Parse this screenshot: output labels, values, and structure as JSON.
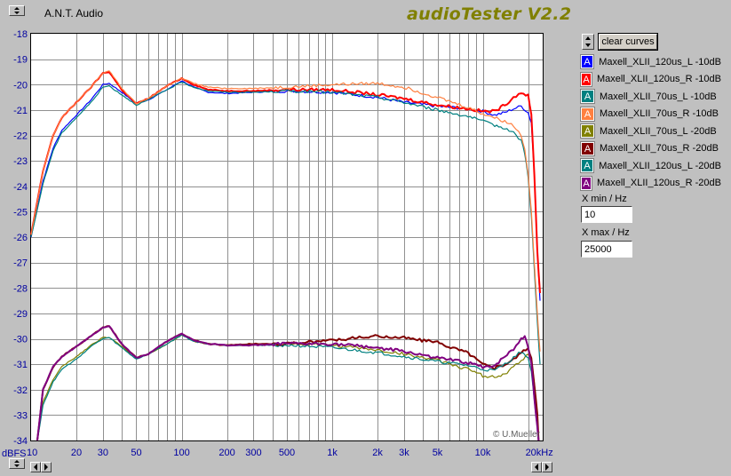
{
  "window": {
    "title": "A.N.T. Audio",
    "brand": "audioTester V2.2"
  },
  "controls": {
    "clear_curves_label": "clear curves",
    "xmin_label": "X min / Hz",
    "xmin_value": "10",
    "xmax_label": "X max / Hz",
    "xmax_value": "25000"
  },
  "legend_items": [
    {
      "label": "Maxell_XLII_120us_L -10dB",
      "color": "#0000ff",
      "glyph": "A"
    },
    {
      "label": "Maxell_XLII_120us_R -10dB",
      "color": "#ff0000",
      "glyph": "A"
    },
    {
      "label": "Maxell_XLII_70us_L -10dB",
      "color": "#008080",
      "glyph": "A"
    },
    {
      "label": "Maxell_XLII_70us_R -10dB",
      "color": "#ff8040",
      "glyph": "A"
    },
    {
      "label": "Maxell_XLII_70us_L -20dB",
      "color": "#808000",
      "glyph": "A"
    },
    {
      "label": "Maxell_XLII_70us_R -20dB",
      "color": "#800000",
      "glyph": "A"
    },
    {
      "label": "Maxell_XLII_120us_L -20dB",
      "color": "#008080",
      "glyph": "A"
    },
    {
      "label": "Maxell_XLII_120us_R -20dB",
      "color": "#800080",
      "glyph": "A"
    }
  ],
  "chart_data": {
    "type": "line",
    "x_scale": "log",
    "xlim": [
      10,
      25000
    ],
    "ylim": [
      -34,
      -18
    ],
    "ylabel": "dBFS",
    "xticks": [
      {
        "v": 10,
        "label": "10"
      },
      {
        "v": 20,
        "label": "20"
      },
      {
        "v": 30,
        "label": "30"
      },
      {
        "v": 50,
        "label": "50"
      },
      {
        "v": 100,
        "label": "100"
      },
      {
        "v": 200,
        "label": "200"
      },
      {
        "v": 300,
        "label": "300"
      },
      {
        "v": 500,
        "label": "500"
      },
      {
        "v": 1000,
        "label": "1k"
      },
      {
        "v": 2000,
        "label": "2k"
      },
      {
        "v": 3000,
        "label": "3k"
      },
      {
        "v": 5000,
        "label": "5k"
      },
      {
        "v": 10000,
        "label": "10k"
      },
      {
        "v": 20000,
        "label": "20kHz"
      }
    ],
    "yticks": [
      -18,
      -19,
      -20,
      -21,
      -22,
      -23,
      -24,
      -25,
      -26,
      -27,
      -28,
      -29,
      -30,
      -31,
      -32,
      -33,
      -34
    ],
    "grid": true,
    "annotation": "© U.Mueller",
    "series": [
      {
        "name": "Maxell_XLII_120us_L -10dB",
        "color": "#0000ff",
        "points": [
          [
            10,
            -26
          ],
          [
            12,
            -23.8
          ],
          [
            14,
            -22.5
          ],
          [
            16,
            -21.8
          ],
          [
            20,
            -21.2
          ],
          [
            25,
            -20.6
          ],
          [
            30,
            -20.0
          ],
          [
            33,
            -19.95
          ],
          [
            40,
            -20.3
          ],
          [
            50,
            -20.75
          ],
          [
            60,
            -20.6
          ],
          [
            80,
            -20.2
          ],
          [
            100,
            -19.85
          ],
          [
            120,
            -20.1
          ],
          [
            150,
            -20.3
          ],
          [
            200,
            -20.35
          ],
          [
            300,
            -20.3
          ],
          [
            500,
            -20.25
          ],
          [
            1000,
            -20.3
          ],
          [
            2000,
            -20.5
          ],
          [
            3000,
            -20.7
          ],
          [
            5000,
            -20.85
          ],
          [
            8000,
            -20.95
          ],
          [
            10000,
            -21.05
          ],
          [
            12000,
            -21.2
          ],
          [
            14000,
            -21.1
          ],
          [
            16000,
            -20.95
          ],
          [
            18000,
            -20.85
          ],
          [
            20000,
            -21.1
          ],
          [
            21000,
            -21.5
          ],
          [
            22000,
            -23.5
          ],
          [
            23000,
            -26.5
          ],
          [
            24000,
            -28.5
          ]
        ]
      },
      {
        "name": "Maxell_XLII_120us_R -10dB",
        "color": "#ff0000",
        "points": [
          [
            10,
            -25.9
          ],
          [
            12,
            -23.4
          ],
          [
            14,
            -22.0
          ],
          [
            16,
            -21.3
          ],
          [
            20,
            -20.7
          ],
          [
            25,
            -20.1
          ],
          [
            30,
            -19.55
          ],
          [
            33,
            -19.5
          ],
          [
            40,
            -20.2
          ],
          [
            50,
            -20.75
          ],
          [
            60,
            -20.55
          ],
          [
            80,
            -20.05
          ],
          [
            100,
            -19.75
          ],
          [
            120,
            -20.0
          ],
          [
            150,
            -20.2
          ],
          [
            200,
            -20.25
          ],
          [
            300,
            -20.25
          ],
          [
            500,
            -20.2
          ],
          [
            1000,
            -20.2
          ],
          [
            2000,
            -20.4
          ],
          [
            3000,
            -20.55
          ],
          [
            5000,
            -20.8
          ],
          [
            8000,
            -20.95
          ],
          [
            10000,
            -21.05
          ],
          [
            12000,
            -21.05
          ],
          [
            14000,
            -20.8
          ],
          [
            16000,
            -20.5
          ],
          [
            18000,
            -20.3
          ],
          [
            20000,
            -20.45
          ],
          [
            21000,
            -21.2
          ],
          [
            22000,
            -23.5
          ],
          [
            23000,
            -26.5
          ],
          [
            24000,
            -28.2
          ]
        ]
      },
      {
        "name": "Maxell_XLII_70us_L -10dB",
        "color": "#008080",
        "points": [
          [
            10,
            -26
          ],
          [
            12,
            -23.9
          ],
          [
            14,
            -22.6
          ],
          [
            16,
            -21.9
          ],
          [
            20,
            -21.3
          ],
          [
            25,
            -20.7
          ],
          [
            30,
            -20.1
          ],
          [
            33,
            -20.05
          ],
          [
            40,
            -20.4
          ],
          [
            50,
            -20.8
          ],
          [
            60,
            -20.6
          ],
          [
            80,
            -20.2
          ],
          [
            100,
            -19.9
          ],
          [
            120,
            -20.1
          ],
          [
            150,
            -20.25
          ],
          [
            200,
            -20.3
          ],
          [
            300,
            -20.3
          ],
          [
            500,
            -20.25
          ],
          [
            1000,
            -20.3
          ],
          [
            2000,
            -20.5
          ],
          [
            3000,
            -20.7
          ],
          [
            5000,
            -21.0
          ],
          [
            8000,
            -21.25
          ],
          [
            10000,
            -21.45
          ],
          [
            12000,
            -21.6
          ],
          [
            14000,
            -21.7
          ],
          [
            16000,
            -21.9
          ],
          [
            18000,
            -22.2
          ],
          [
            19000,
            -22.7
          ],
          [
            20000,
            -23.6
          ],
          [
            21000,
            -25.2
          ],
          [
            22000,
            -27.3
          ],
          [
            23000,
            -29.3
          ],
          [
            24000,
            -31.0
          ]
        ]
      },
      {
        "name": "Maxell_XLII_70us_R -10dB",
        "color": "#ff8040",
        "points": [
          [
            10,
            -25.9
          ],
          [
            12,
            -23.4
          ],
          [
            14,
            -22.0
          ],
          [
            16,
            -21.3
          ],
          [
            20,
            -20.7
          ],
          [
            25,
            -20.1
          ],
          [
            30,
            -19.55
          ],
          [
            33,
            -19.45
          ],
          [
            40,
            -20.15
          ],
          [
            50,
            -20.75
          ],
          [
            60,
            -20.55
          ],
          [
            80,
            -20.05
          ],
          [
            100,
            -19.75
          ],
          [
            120,
            -19.95
          ],
          [
            150,
            -20.1
          ],
          [
            200,
            -20.15
          ],
          [
            300,
            -20.15
          ],
          [
            500,
            -20.1
          ],
          [
            1000,
            -20.0
          ],
          [
            2000,
            -19.95
          ],
          [
            3000,
            -20.1
          ],
          [
            5000,
            -20.5
          ],
          [
            8000,
            -20.9
          ],
          [
            10000,
            -21.15
          ],
          [
            12000,
            -21.3
          ],
          [
            14000,
            -21.45
          ],
          [
            16000,
            -21.6
          ],
          [
            18000,
            -22.0
          ],
          [
            19000,
            -22.5
          ],
          [
            20000,
            -23.5
          ],
          [
            21000,
            -25.0
          ],
          [
            22000,
            -27.0
          ],
          [
            23000,
            -29.0
          ],
          [
            24000,
            -30.5
          ]
        ]
      },
      {
        "name": "Maxell_XLII_70us_L -20dB",
        "color": "#808000",
        "points": [
          [
            11,
            -34
          ],
          [
            12,
            -32.5
          ],
          [
            14,
            -31.6
          ],
          [
            16,
            -31.1
          ],
          [
            20,
            -30.7
          ],
          [
            25,
            -30.25
          ],
          [
            30,
            -29.95
          ],
          [
            33,
            -29.95
          ],
          [
            40,
            -30.3
          ],
          [
            50,
            -30.75
          ],
          [
            60,
            -30.6
          ],
          [
            80,
            -30.2
          ],
          [
            100,
            -29.85
          ],
          [
            120,
            -30.1
          ],
          [
            150,
            -30.2
          ],
          [
            200,
            -30.25
          ],
          [
            300,
            -30.25
          ],
          [
            500,
            -30.2
          ],
          [
            1000,
            -30.25
          ],
          [
            2000,
            -30.45
          ],
          [
            3000,
            -30.6
          ],
          [
            5000,
            -30.85
          ],
          [
            8000,
            -31.2
          ],
          [
            10000,
            -31.45
          ],
          [
            12000,
            -31.5
          ],
          [
            14000,
            -31.4
          ],
          [
            16000,
            -31.1
          ],
          [
            18000,
            -30.9
          ],
          [
            20000,
            -30.6
          ],
          [
            21000,
            -30.8
          ],
          [
            22000,
            -31.8
          ],
          [
            23000,
            -33.0
          ],
          [
            23500,
            -34
          ]
        ]
      },
      {
        "name": "Maxell_XLII_70us_R -20dB",
        "color": "#800000",
        "points": [
          [
            11,
            -34
          ],
          [
            12,
            -32.0
          ],
          [
            14,
            -31.1
          ],
          [
            16,
            -30.7
          ],
          [
            20,
            -30.3
          ],
          [
            25,
            -29.9
          ],
          [
            30,
            -29.55
          ],
          [
            33,
            -29.5
          ],
          [
            40,
            -30.2
          ],
          [
            50,
            -30.75
          ],
          [
            60,
            -30.6
          ],
          [
            80,
            -30.1
          ],
          [
            100,
            -29.8
          ],
          [
            120,
            -30.05
          ],
          [
            150,
            -30.2
          ],
          [
            200,
            -30.25
          ],
          [
            300,
            -30.2
          ],
          [
            500,
            -30.2
          ],
          [
            1000,
            -30.05
          ],
          [
            2000,
            -29.9
          ],
          [
            3000,
            -29.95
          ],
          [
            5000,
            -30.15
          ],
          [
            8000,
            -30.55
          ],
          [
            10000,
            -31.0
          ],
          [
            12000,
            -31.15
          ],
          [
            14000,
            -31.0
          ],
          [
            16000,
            -30.8
          ],
          [
            18000,
            -30.55
          ],
          [
            20000,
            -30.4
          ],
          [
            21000,
            -30.7
          ],
          [
            22000,
            -31.8
          ],
          [
            23000,
            -33.0
          ],
          [
            23500,
            -34
          ]
        ]
      },
      {
        "name": "Maxell_XLII_120us_L -20dB",
        "color": "#008080",
        "points": [
          [
            11,
            -34
          ],
          [
            12,
            -32.6
          ],
          [
            14,
            -31.7
          ],
          [
            16,
            -31.2
          ],
          [
            20,
            -30.8
          ],
          [
            25,
            -30.3
          ],
          [
            30,
            -30.0
          ],
          [
            33,
            -29.95
          ],
          [
            40,
            -30.35
          ],
          [
            50,
            -30.8
          ],
          [
            60,
            -30.6
          ],
          [
            80,
            -30.2
          ],
          [
            100,
            -29.85
          ],
          [
            120,
            -30.1
          ],
          [
            150,
            -30.2
          ],
          [
            200,
            -30.25
          ],
          [
            300,
            -30.25
          ],
          [
            500,
            -30.25
          ],
          [
            1000,
            -30.35
          ],
          [
            2000,
            -30.55
          ],
          [
            3000,
            -30.7
          ],
          [
            5000,
            -30.9
          ],
          [
            8000,
            -31.05
          ],
          [
            10000,
            -31.2
          ],
          [
            12000,
            -31.25
          ],
          [
            14000,
            -31.0
          ],
          [
            16000,
            -30.75
          ],
          [
            18000,
            -30.5
          ],
          [
            20000,
            -30.7
          ],
          [
            21000,
            -31.3
          ],
          [
            22000,
            -32.4
          ],
          [
            23000,
            -33.5
          ],
          [
            23500,
            -34
          ]
        ]
      },
      {
        "name": "Maxell_XLII_120us_R -20dB",
        "color": "#800080",
        "points": [
          [
            11,
            -34
          ],
          [
            12,
            -32.0
          ],
          [
            14,
            -31.1
          ],
          [
            16,
            -30.7
          ],
          [
            20,
            -30.3
          ],
          [
            25,
            -29.9
          ],
          [
            30,
            -29.55
          ],
          [
            33,
            -29.5
          ],
          [
            40,
            -30.2
          ],
          [
            50,
            -30.75
          ],
          [
            60,
            -30.6
          ],
          [
            80,
            -30.1
          ],
          [
            100,
            -29.8
          ],
          [
            120,
            -30.05
          ],
          [
            150,
            -30.2
          ],
          [
            200,
            -30.25
          ],
          [
            300,
            -30.25
          ],
          [
            500,
            -30.2
          ],
          [
            1000,
            -30.2
          ],
          [
            2000,
            -30.35
          ],
          [
            3000,
            -30.5
          ],
          [
            5000,
            -30.75
          ],
          [
            8000,
            -30.95
          ],
          [
            10000,
            -31.1
          ],
          [
            12000,
            -31.05
          ],
          [
            14000,
            -30.7
          ],
          [
            16000,
            -30.4
          ],
          [
            18000,
            -30.0
          ],
          [
            19000,
            -29.9
          ],
          [
            20000,
            -30.3
          ],
          [
            21000,
            -31.0
          ],
          [
            22000,
            -32.3
          ],
          [
            23000,
            -33.5
          ],
          [
            23500,
            -34
          ]
        ]
      }
    ]
  }
}
